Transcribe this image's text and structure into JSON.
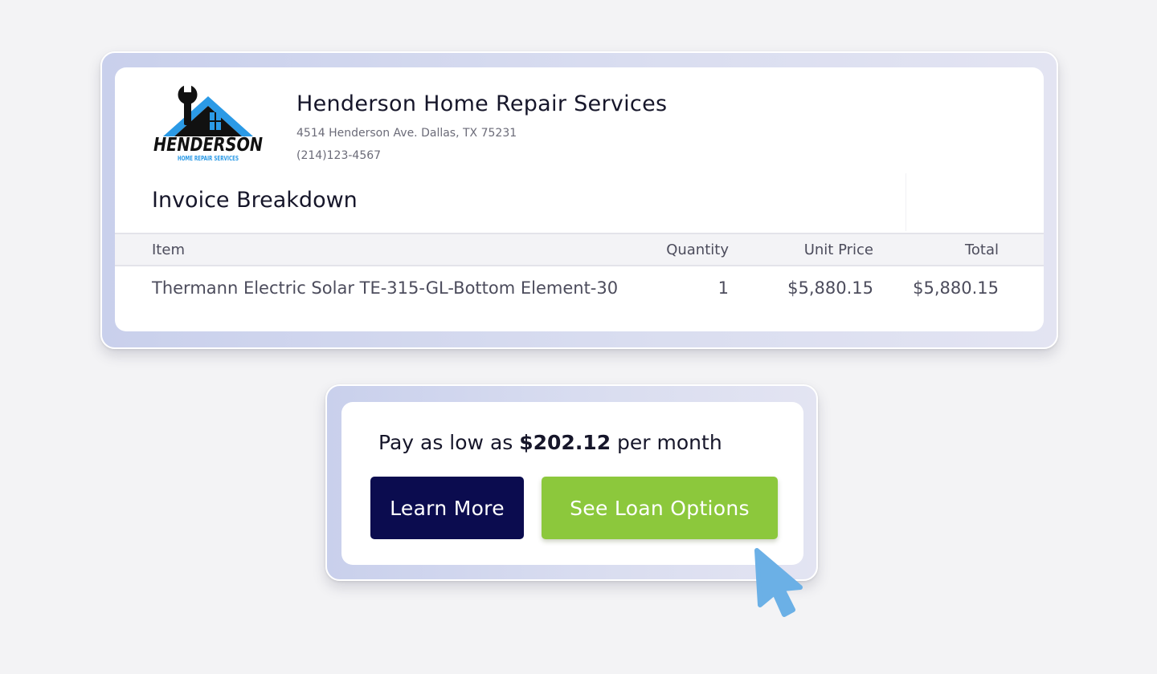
{
  "company": {
    "name": "Henderson Home Repair Services",
    "address": "4514 Henderson Ave. Dallas, TX 75231",
    "phone": "(214)123-4567",
    "logo": {
      "wordmark": "HENDERSON",
      "tagline": "HOME REPAIR SERVICES",
      "icon": "house-wrench-logo"
    }
  },
  "invoice": {
    "title": "Invoice Breakdown",
    "columns": {
      "item": "Item",
      "quantity": "Quantity",
      "unit_price": "Unit Price",
      "total": "Total"
    },
    "rows": [
      {
        "item": "Thermann Electric Solar TE-315-GL-Bottom Element-30",
        "quantity": "1",
        "unit_price": "$5,880.15",
        "total": "$5,880.15"
      }
    ]
  },
  "financing": {
    "prefix": "Pay as low as ",
    "amount": "$202.12",
    "suffix": " per month",
    "learn_more_label": "Learn More",
    "loan_options_label": "See Loan Options"
  },
  "colors": {
    "primary_navy": "#0b0c4f",
    "accent_green": "#8cc83c",
    "logo_blue": "#2b9ae6",
    "cursor_blue": "#6bb0e6"
  },
  "icons": {
    "cursor": "mouse-pointer-icon"
  }
}
